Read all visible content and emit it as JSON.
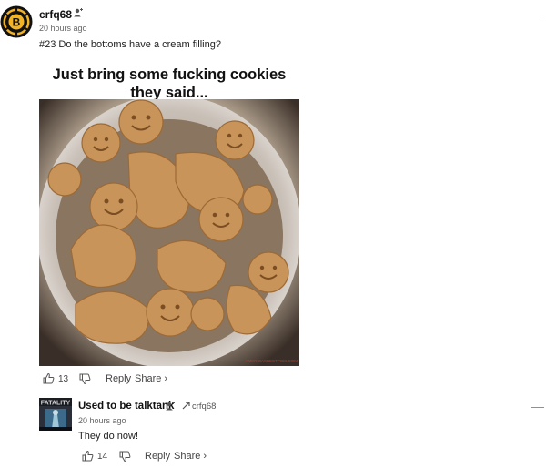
{
  "comments": [
    {
      "username": "crfq68",
      "timestamp": "20 hours ago",
      "text": "#23 Do the bottoms have a cream filling?",
      "meme": {
        "caption": "Just bring some fucking cookies they said...",
        "watermark": "AMERICASBESTPICS.COM"
      },
      "upvotes": "13",
      "reply_label": "Reply",
      "share_label": "Share ›"
    },
    {
      "username": "Used to be talktank",
      "reply_to": "crfq68",
      "timestamp": "20 hours ago",
      "text": "They do now!",
      "upvotes": "14",
      "reply_label": "Reply",
      "share_label": "Share ›"
    }
  ],
  "colors": {
    "bruins_gold": "#f4b323",
    "text_muted": "#666666"
  },
  "icons": [
    "avatar-bruins-logo",
    "follow-user-icon",
    "more-options-icon",
    "thumbs-up-icon",
    "thumbs-down-icon",
    "reply-arrow-icon"
  ]
}
